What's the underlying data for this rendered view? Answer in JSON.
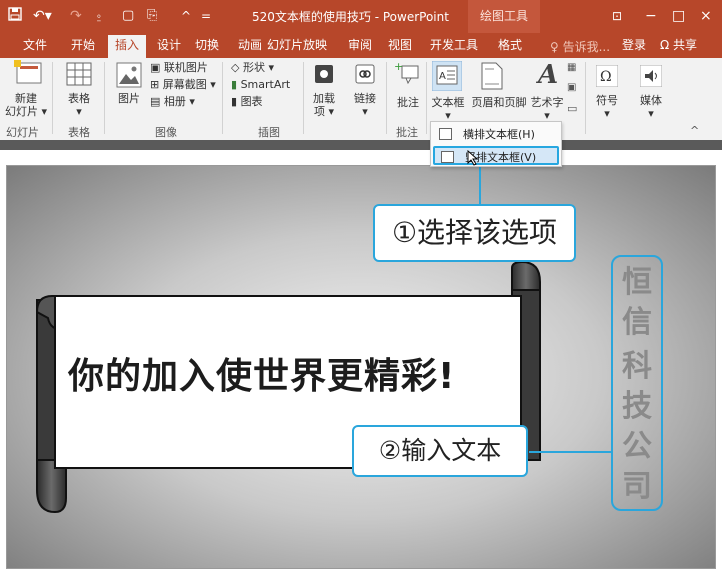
{
  "window": {
    "title": "520文本框的使用技巧 - PowerPoint",
    "context_tool": "绘图工具",
    "quick_access": {
      "save_icon": "save-icon",
      "undo_icon": "undo-icon",
      "redo_icon": "redo-icon"
    },
    "controls": {
      "ribbon_options": "⊡",
      "minimize": "−",
      "maximize": "□",
      "close": "×"
    }
  },
  "tabs": {
    "file": "文件",
    "home": "开始",
    "insert": "插入",
    "design": "设计",
    "transitions": "切换",
    "animations": "动画",
    "slideshow": "幻灯片放映",
    "review": "审阅",
    "view": "视图",
    "developer": "开发工具",
    "format": "格式",
    "tell_me": "♀ 告诉我...",
    "login": "登录",
    "share": "Ω 共享"
  },
  "ribbon": {
    "slides": {
      "new_slide": "新建\n幻灯片 ▾",
      "group": "幻灯片"
    },
    "tables": {
      "table": "表格\n▾",
      "group": "表格"
    },
    "images": {
      "picture": "图片",
      "online_pictures": "联机图片",
      "screenshot": "屏幕截图 ▾",
      "album": "相册 ▾",
      "group": "图像"
    },
    "illustrations": {
      "shapes": "形状 ▾",
      "smartart": "SmartArt",
      "chart": "图表",
      "group": "插图"
    },
    "links": {
      "addins": "加载\n项 ▾",
      "link": "链接\n▾"
    },
    "comments": {
      "comment": "批注",
      "group": "批注"
    },
    "text": {
      "textbox": "文本框\n▾",
      "header_footer": "页眉和页脚",
      "wordart": "艺术字\n▾"
    },
    "symbols": {
      "symbol": "符号\n▾"
    },
    "media": {
      "media": "媒体\n▾"
    }
  },
  "dropdown": {
    "horizontal": "横排文本框(H)",
    "vertical": "竖排文本框(V)"
  },
  "slide": {
    "callout1": "①选择该选项",
    "callout2": "②输入文本",
    "main_text": "你的加入使世界更精彩!",
    "vertical_text": [
      "恒",
      "信",
      "科",
      "技",
      "公",
      "司"
    ]
  },
  "colors": {
    "accent": "#b7472a",
    "callout_border": "#2aa6dc"
  }
}
